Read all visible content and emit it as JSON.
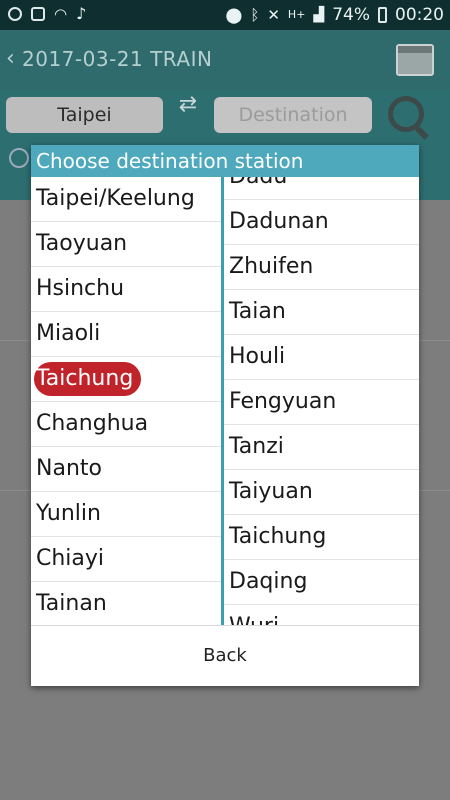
{
  "statusbar": {
    "battery": "74%",
    "time": "00:20",
    "network": "H+"
  },
  "header": {
    "back_glyph": "‹",
    "title": "2017-03-21 TRAIN"
  },
  "selector": {
    "from_station": "Taipei",
    "to_station": "Destination"
  },
  "dialog": {
    "title": "Choose destination station",
    "regions": [
      {
        "label": "Taipei/Keelung",
        "selected": false
      },
      {
        "label": "Taoyuan",
        "selected": false
      },
      {
        "label": "Hsinchu",
        "selected": false
      },
      {
        "label": "Miaoli",
        "selected": false
      },
      {
        "label": "Taichung",
        "selected": true
      },
      {
        "label": "Changhua",
        "selected": false
      },
      {
        "label": "Nanto",
        "selected": false
      },
      {
        "label": "Yunlin",
        "selected": false
      },
      {
        "label": "Chiayi",
        "selected": false
      },
      {
        "label": "Tainan",
        "selected": false
      }
    ],
    "stations": [
      "Dadu",
      "Dadunan",
      "Zhuifen",
      "Taian",
      "Houli",
      "Fengyuan",
      "Tanzi",
      "Taiyuan",
      "Taichung",
      "Daqing",
      "Wuri"
    ],
    "back_label": "Back"
  },
  "colors": {
    "accent": "#4ea9bd",
    "selected_pill": "#c0242a"
  }
}
